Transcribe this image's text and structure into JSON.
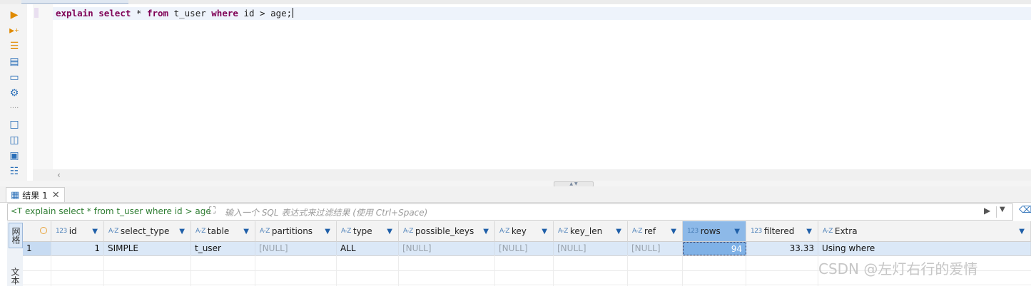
{
  "editor": {
    "sql_tokens": [
      {
        "text": "explain",
        "kw": true
      },
      {
        "text": " ",
        "kw": false
      },
      {
        "text": "select",
        "kw": true
      },
      {
        "text": " * ",
        "kw": false
      },
      {
        "text": "from",
        "kw": true
      },
      {
        "text": " t_user ",
        "kw": false
      },
      {
        "text": "where",
        "kw": true
      },
      {
        "text": " id > age;",
        "kw": false
      }
    ]
  },
  "left_toolbar": {
    "icons": [
      "execute-statement-icon",
      "execute-statement-new-tab-icon",
      "execute-script-icon",
      "explain-plan-icon",
      "console-icon",
      "settings-icon",
      "more-icon",
      "new-script-icon",
      "open-script-icon",
      "export-icon",
      "outline-icon"
    ]
  },
  "results": {
    "tab_label": "结果 1",
    "filter": {
      "query_text": "explain select * from t_user where id > age",
      "placeholder": "输入一个 SQL 表达式来过滤结果 (使用 Ctrl+Space)"
    },
    "side_tabs": [
      "网格",
      "文本"
    ],
    "columns": [
      {
        "type": "123",
        "name": "id"
      },
      {
        "type": "A-Z",
        "name": "select_type"
      },
      {
        "type": "A-Z",
        "name": "table"
      },
      {
        "type": "A-Z",
        "name": "partitions"
      },
      {
        "type": "A-Z",
        "name": "type"
      },
      {
        "type": "A-Z",
        "name": "possible_keys"
      },
      {
        "type": "A-Z",
        "name": "key"
      },
      {
        "type": "A-Z",
        "name": "key_len"
      },
      {
        "type": "A-Z",
        "name": "ref"
      },
      {
        "type": "123",
        "name": "rows"
      },
      {
        "type": "123",
        "name": "filtered"
      },
      {
        "type": "A-Z",
        "name": "Extra"
      }
    ],
    "rows": [
      {
        "row_number": "1",
        "cells": [
          "1",
          "SIMPLE",
          "t_user",
          "[NULL]",
          "ALL",
          "[NULL]",
          "[NULL]",
          "[NULL]",
          "[NULL]",
          "94",
          "33.33",
          "Using where"
        ]
      }
    ],
    "selected_column": "rows"
  },
  "watermark": "CSDN @左灯右行的爱情"
}
